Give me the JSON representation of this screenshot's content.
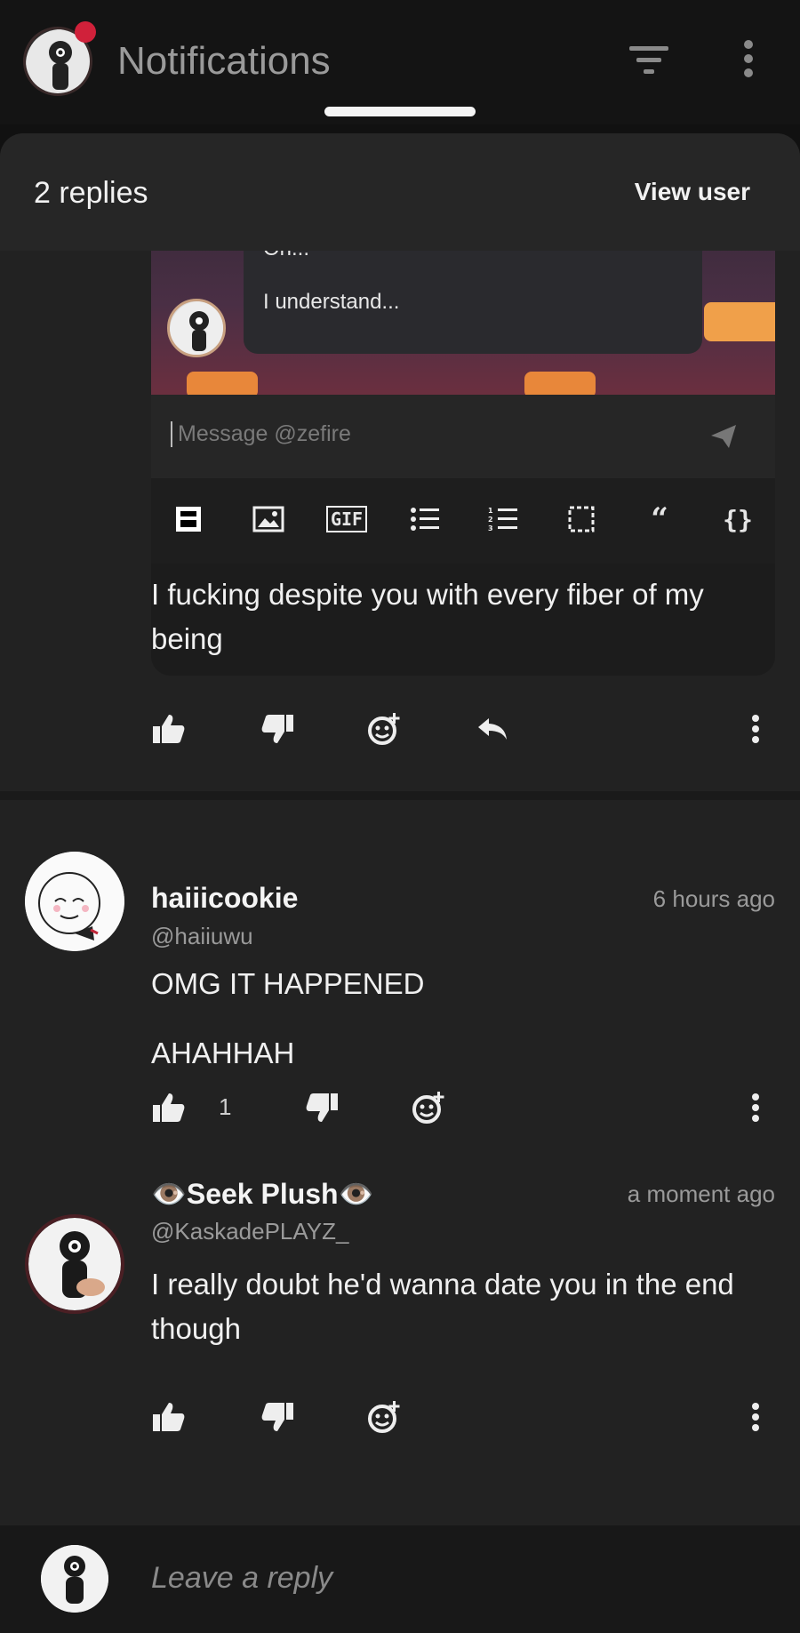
{
  "appbar": {
    "title": "Notifications",
    "icons": {
      "filter": "filter-icon",
      "more": "more-vertical-icon"
    }
  },
  "sheet": {
    "replies_count": "2 replies",
    "view_user": "View user"
  },
  "embed": {
    "line1": "Oh...",
    "line2": "I understand...",
    "message_placeholder": "Message @zefire",
    "tools": [
      "emoji-icon",
      "image-icon",
      "GIF",
      "bullet-list-icon",
      "numbered-list-icon",
      "spoiler-icon",
      "quote-icon",
      "code-icon"
    ],
    "tool_labels": {
      "gif": "GIF",
      "quote": "“",
      "code": "{}"
    }
  },
  "parent_comment": {
    "text": "I fucking despite you with every fiber of my being",
    "actions": [
      "thumbs-up-icon",
      "thumbs-down-icon",
      "add-reaction-icon",
      "reply-icon",
      "more-vertical-icon"
    ]
  },
  "comments": [
    {
      "name": "haiiicookie",
      "handle": "@haiiuwu",
      "time": "6 hours ago",
      "lines": [
        "OMG IT HAPPENED",
        "AHAHHAH"
      ],
      "likes": "1"
    },
    {
      "name": "👁️Seek Plush👁️",
      "handle": "@KaskadePLAYZ_",
      "time": "a moment ago",
      "text": "I really doubt he'd wanna date you in the end though"
    }
  ],
  "reply_bar": {
    "placeholder": "Leave a reply"
  },
  "colors": {
    "background": "#222222",
    "appbar": "#141414",
    "notification_dot": "#d0213a",
    "text_primary": "#f0f0f0",
    "text_secondary": "#9a9a9a"
  }
}
